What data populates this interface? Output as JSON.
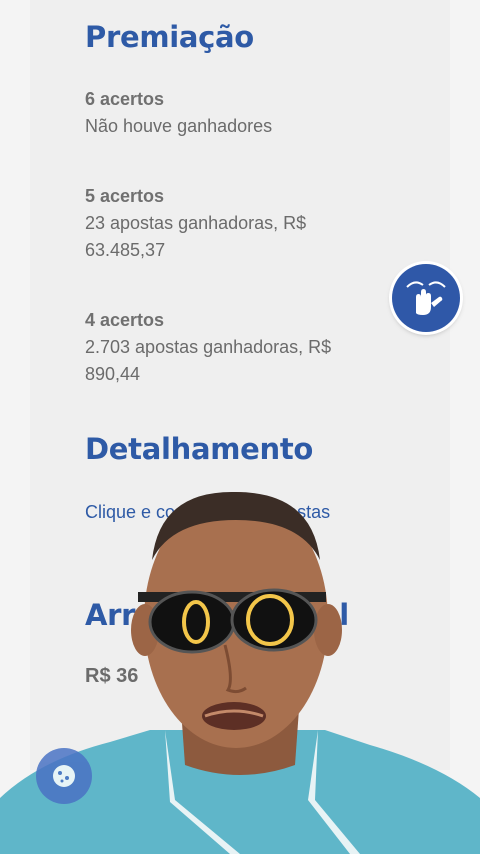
{
  "premiacao": {
    "title": "Premiação",
    "tiers": [
      {
        "hits": "6 acertos",
        "result": "Não houve ganhadores"
      },
      {
        "hits": "5 acertos",
        "result": "23 apostas ganhadoras, R$ 63.485,37"
      },
      {
        "hits": "4 acertos",
        "result": "2.703 apostas ganhadoras, R$ 890,44"
      }
    ]
  },
  "detalhamento": {
    "title": "Detalhamento",
    "link_text": "Clique e co          talhes das apostas"
  },
  "arrecadacao": {
    "title_left": "Arre",
    "title_right": "al",
    "value": "R$ 36"
  },
  "icons": {
    "libras": "sign-language-hands-icon",
    "cookie": "cookie-icon"
  },
  "colors": {
    "accent": "#2e5aa6",
    "text_gray": "#6b6b6b",
    "shirt": "#5fb6c9"
  }
}
